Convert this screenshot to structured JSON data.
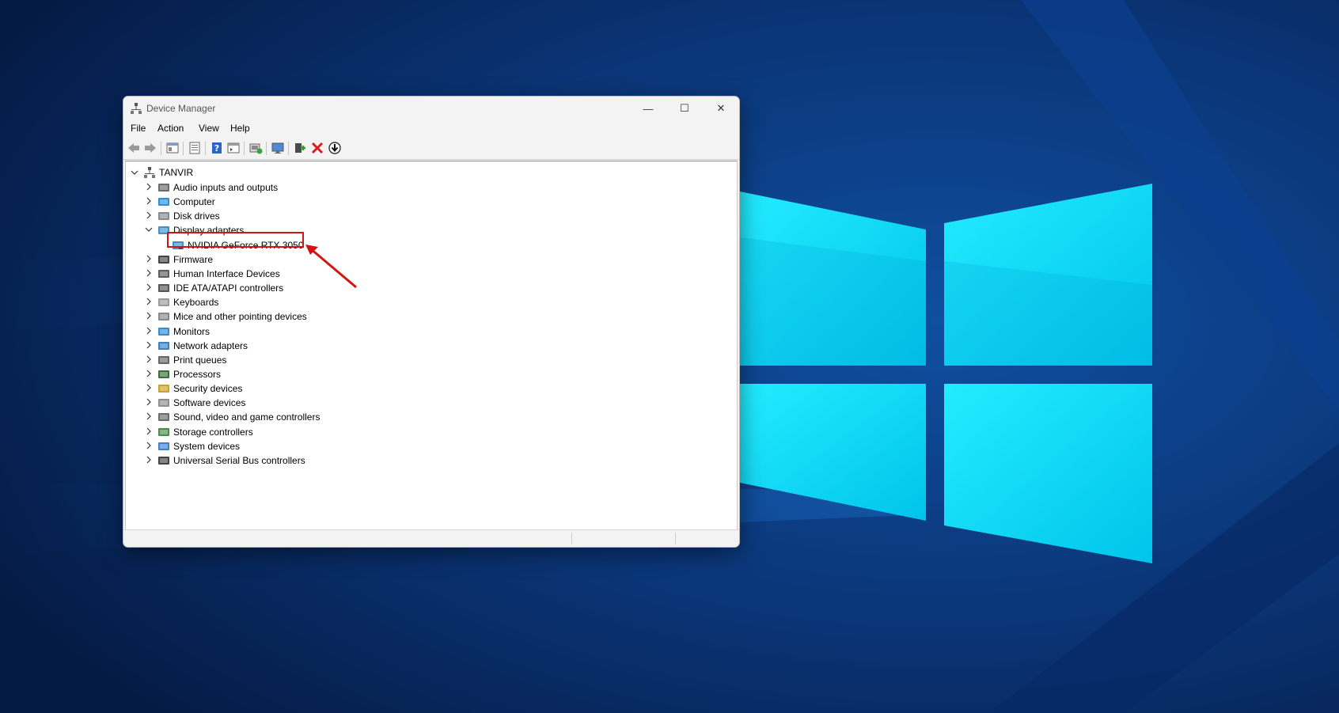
{
  "window": {
    "title": "Device Manager",
    "controls": {
      "minimize": "—",
      "maximize": "☐",
      "close": "✕"
    }
  },
  "menu": [
    "File",
    "Action",
    "View",
    "Help"
  ],
  "toolbar": {
    "icons": [
      "back-icon",
      "forward-icon",
      "show-hide-console-tree-icon",
      "properties-icon",
      "help-icon",
      "console-view-icon",
      "update-driver-icon",
      "scan-hardware-icon",
      "enable-device-icon",
      "uninstall-device-icon",
      "download-driver-icon"
    ]
  },
  "tree": {
    "root": "TANVIR",
    "categories": [
      {
        "label": "Audio inputs and outputs",
        "icon": "speaker-icon"
      },
      {
        "label": "Computer",
        "icon": "computer-icon"
      },
      {
        "label": "Disk drives",
        "icon": "disk-drive-icon"
      },
      {
        "label": "Display adapters",
        "icon": "display-adapter-icon",
        "expanded": true
      },
      {
        "label": "Firmware",
        "icon": "firmware-icon"
      },
      {
        "label": "Human Interface Devices",
        "icon": "hid-icon"
      },
      {
        "label": "IDE ATA/ATAPI controllers",
        "icon": "ide-controller-icon"
      },
      {
        "label": "Keyboards",
        "icon": "keyboard-icon"
      },
      {
        "label": "Mice and other pointing devices",
        "icon": "mouse-icon"
      },
      {
        "label": "Monitors",
        "icon": "monitor-icon"
      },
      {
        "label": "Network adapters",
        "icon": "network-adapter-icon"
      },
      {
        "label": "Print queues",
        "icon": "printer-icon"
      },
      {
        "label": "Processors",
        "icon": "processor-icon"
      },
      {
        "label": "Security devices",
        "icon": "security-device-icon"
      },
      {
        "label": "Software devices",
        "icon": "software-device-icon"
      },
      {
        "label": "Sound, video and game controllers",
        "icon": "sound-controller-icon"
      },
      {
        "label": "Storage controllers",
        "icon": "storage-controller-icon"
      },
      {
        "label": "System devices",
        "icon": "system-device-icon"
      },
      {
        "label": "Universal Serial Bus controllers",
        "icon": "usb-icon"
      }
    ],
    "display_adapter_child": "NVIDIA GeForce RTX 3050"
  },
  "colors": {
    "annotation_red": "#d41414",
    "wallpaper_light": "#00d7f5",
    "wallpaper_dark": "#062a5c"
  }
}
